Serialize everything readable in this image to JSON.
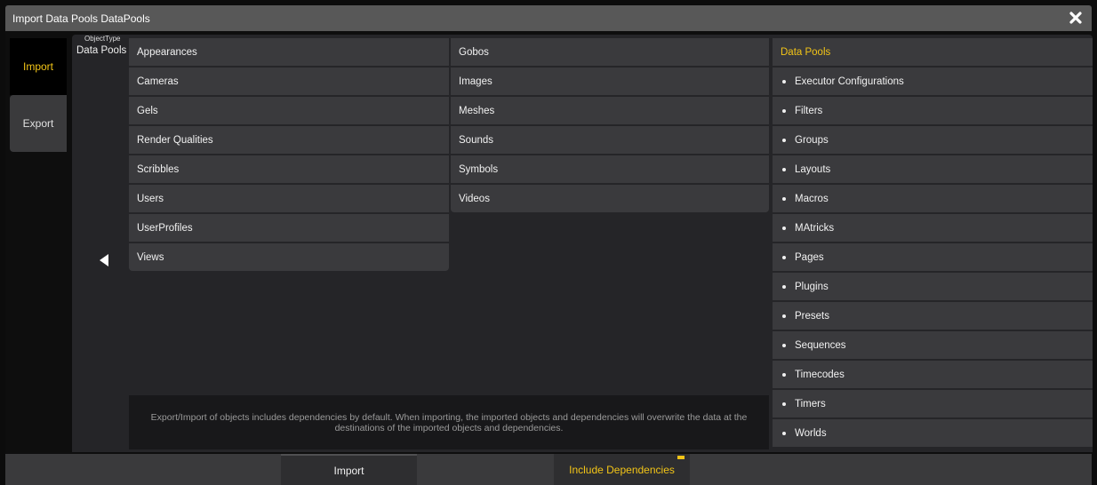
{
  "window": {
    "title": "Import Data Pools DataPools"
  },
  "tabs": [
    {
      "label": "Import",
      "active": true
    },
    {
      "label": "Export",
      "active": false
    }
  ],
  "object_type": {
    "caption": "ObjectType",
    "value": "Data Pools"
  },
  "column_a": [
    "Appearances",
    "Cameras",
    "Gels",
    "Render Qualities",
    "Scribbles",
    "Users",
    "UserProfiles",
    "Views"
  ],
  "column_b": [
    "Gobos",
    "Images",
    "Meshes",
    "Sounds",
    "Symbols",
    "Videos"
  ],
  "column_c": {
    "header": "Data Pools",
    "items": [
      "Executor Configurations",
      "Filters",
      "Groups",
      "Layouts",
      "Macros",
      "MAtricks",
      "Pages",
      "Plugins",
      "Presets",
      "Sequences",
      "Timecodes",
      "Timers",
      "Worlds"
    ]
  },
  "info_text": "Export/Import of objects includes dependencies by default. When importing, the imported objects and dependencies will overwrite the data at the destinations of the imported objects and dependencies.",
  "buttons": {
    "import_label": "Import",
    "include_dependencies_label": "Include Dependencies"
  },
  "icons": {
    "close": "close-icon",
    "back": "back-arrow-icon"
  },
  "colors": {
    "accent": "#f2c417",
    "title_bar": "#585858",
    "panel": "#252528",
    "item": "#3a3a3d"
  }
}
